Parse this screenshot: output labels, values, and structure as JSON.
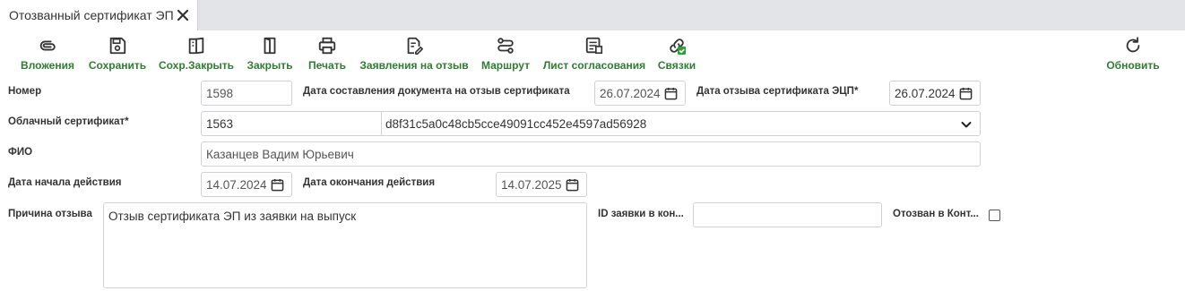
{
  "tab": {
    "title": "Отозванный сертификат ЭП"
  },
  "toolbar": {
    "attachments": "Вложения",
    "save": "Сохранить",
    "save_close": "Сохр.Закрыть",
    "close": "Закрыть",
    "print": "Печать",
    "revoke_requests": "Заявления на отзыв",
    "route": "Маршрут",
    "approval_sheet": "Лист согласования",
    "links": "Связки",
    "refresh": "Обновить"
  },
  "form": {
    "number_label": "Номер",
    "number_value": "1598",
    "doc_date_label": "Дата составления документа на отзыв сертификата",
    "doc_date_value": "26.07.2024",
    "revoke_date_label": "Дата отзыва сертификата ЭЦП*",
    "revoke_date_value": "26.07.2024",
    "cloud_cert_label": "Облачный сертификат*",
    "cloud_cert_id": "1563",
    "cloud_cert_hash": "d8f31c5a0c48cb5cce49091cc452e4597ad56928",
    "fio_label": "ФИО",
    "fio_value": "Казанцев Вадим Юрьевич",
    "start_label": "Дата начала действия",
    "start_value": "14.07.2024",
    "end_label": "Дата окончания действия",
    "end_value": "14.07.2025",
    "reason_label": "Причина отзыва",
    "reason_value": "Отзыв сертификата ЭП из заявки на выпуск",
    "request_id_label": "ID заявки в кон...",
    "request_id_value": "",
    "revoked_in_label": "Отозван в Конт..."
  },
  "colors": {
    "accent": "#2e7d32",
    "tabbar": "#e3e4e8",
    "border": "#cfd2d6"
  }
}
